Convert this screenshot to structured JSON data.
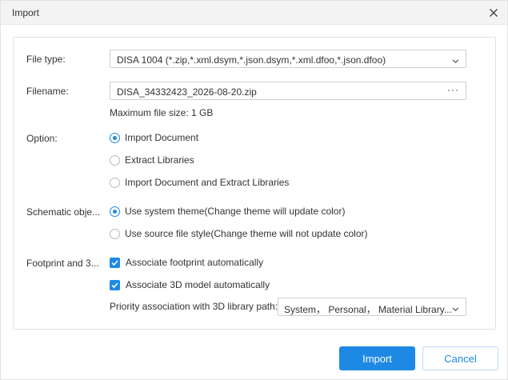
{
  "dialog": {
    "title": "Import",
    "close_icon": "close-icon"
  },
  "form": {
    "file_type": {
      "label": "File type:",
      "value": "DISA 1004 (*.zip,*.xml.dsym,*.json.dsym,*.xml.dfoo,*.json.dfoo)"
    },
    "filename": {
      "label": "Filename:",
      "value": "DISA_34332423_2026-08-20.zip",
      "browse": "···"
    },
    "max_size": "Maximum file size: 1 GB",
    "option": {
      "label": "Option:",
      "choices": [
        "Import Document",
        "Extract Libraries",
        "Import Document and Extract Libraries"
      ],
      "selected": "Import Document"
    },
    "schematic": {
      "label": "Schematic obje...",
      "choices": [
        "Use system theme(Change theme will update color)",
        "Use source file style(Change theme will not update color)"
      ],
      "selected": "Use system theme(Change theme will update color)"
    },
    "footprint": {
      "label": "Footprint and 3...",
      "checks": [
        {
          "label": "Associate footprint automatically",
          "checked": true
        },
        {
          "label": "Associate 3D model automatically",
          "checked": true
        }
      ],
      "priority_label": "Priority association with 3D library path:",
      "priority_value": "System， Personal， Material Library..."
    }
  },
  "buttons": {
    "import": "Import",
    "cancel": "Cancel"
  },
  "colors": {
    "accent": "#1e88e5",
    "border": "#cfcfcf",
    "titlebar": "#f4f4f4"
  }
}
